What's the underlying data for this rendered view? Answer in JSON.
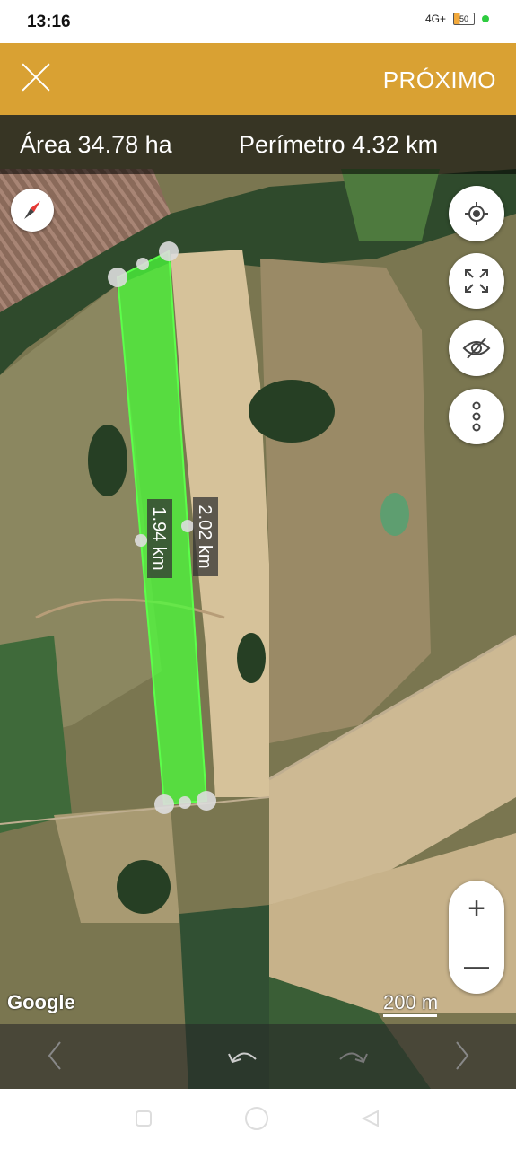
{
  "status_bar": {
    "time": "13:16",
    "network": "4G+",
    "battery": "50",
    "colors": {
      "dot": "#2ecc40",
      "battery_fill": "#f2a93b"
    }
  },
  "app_bar": {
    "close_icon": "close-icon",
    "next_label": "PRÓXIMO",
    "background": "#d9a133"
  },
  "map": {
    "area_label": "Área 34.78 ha",
    "perimeter_label": "Perímetro 4.32 km",
    "edge_labels": [
      "2.02 km",
      "1.94 km"
    ],
    "polygon_fill": "#4cff3b",
    "buttons": [
      "compass-icon",
      "my-location-icon",
      "fullscreen-icon",
      "visibility-off-icon",
      "more-vert-icon"
    ],
    "zoom": {
      "in": "+",
      "out": "—"
    },
    "attribution": "Google",
    "scale": "200 m"
  },
  "toolbar": {
    "icons": [
      "chevron-left-icon",
      "undo-icon",
      "redo-icon",
      "chevron-right-icon"
    ]
  },
  "nav_bar": {
    "icons": [
      "recents-icon",
      "home-icon",
      "back-icon"
    ]
  }
}
